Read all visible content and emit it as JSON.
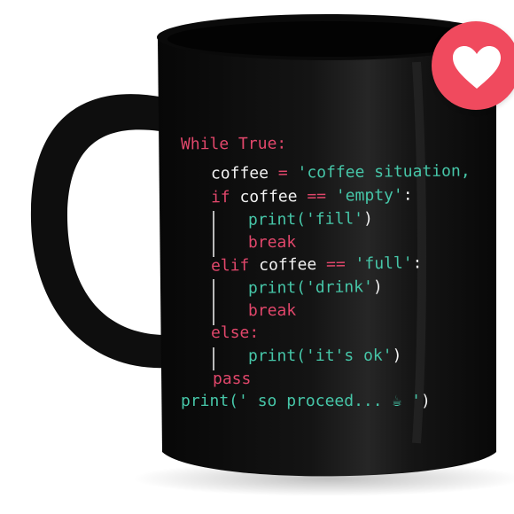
{
  "mug": {
    "body_color": "#121212",
    "code_lines": [
      {
        "parts": [
          {
            "t": "While True:",
            "c": "kw"
          }
        ]
      },
      {
        "parts": [
          {
            "t": "coffee",
            "c": "id"
          },
          {
            "t": " = ",
            "c": "op"
          },
          {
            "t": "'coffee situation,",
            "c": "str"
          }
        ]
      },
      {
        "parts": [
          {
            "t": "if",
            "c": "kw"
          },
          {
            "t": " coffee ",
            "c": "id"
          },
          {
            "t": "==",
            "c": "op"
          },
          {
            "t": " 'empty'",
            "c": "str"
          },
          {
            "t": ":",
            "c": "pn"
          }
        ]
      },
      {
        "parts": [
          {
            "t": "print(",
            "c": "fn"
          },
          {
            "t": "'fill'",
            "c": "str"
          },
          {
            "t": ")",
            "c": "pn"
          }
        ]
      },
      {
        "parts": [
          {
            "t": "break",
            "c": "kw"
          }
        ]
      },
      {
        "parts": [
          {
            "t": "elif",
            "c": "kw"
          },
          {
            "t": " coffee ",
            "c": "id"
          },
          {
            "t": "==",
            "c": "op"
          },
          {
            "t": " 'full'",
            "c": "str"
          },
          {
            "t": ":",
            "c": "pn"
          }
        ]
      },
      {
        "parts": [
          {
            "t": "print(",
            "c": "fn"
          },
          {
            "t": "'drink'",
            "c": "str"
          },
          {
            "t": ")",
            "c": "pn"
          }
        ]
      },
      {
        "parts": [
          {
            "t": "break",
            "c": "kw"
          }
        ]
      },
      {
        "parts": [
          {
            "t": "else:",
            "c": "kw"
          }
        ]
      },
      {
        "parts": [
          {
            "t": "print(",
            "c": "fn"
          },
          {
            "t": "'it's ok'",
            "c": "str"
          },
          {
            "t": ")",
            "c": "pn"
          }
        ]
      },
      {
        "parts": [
          {
            "t": "pass",
            "c": "kw"
          }
        ]
      },
      {
        "parts": [
          {
            "t": "print(",
            "c": "fn"
          },
          {
            "t": "' so proceed... ☕ '",
            "c": "str"
          },
          {
            "t": ")",
            "c": "pn"
          }
        ]
      }
    ]
  },
  "badge": {
    "icon": "heart-icon",
    "color": "#f04a5e"
  }
}
